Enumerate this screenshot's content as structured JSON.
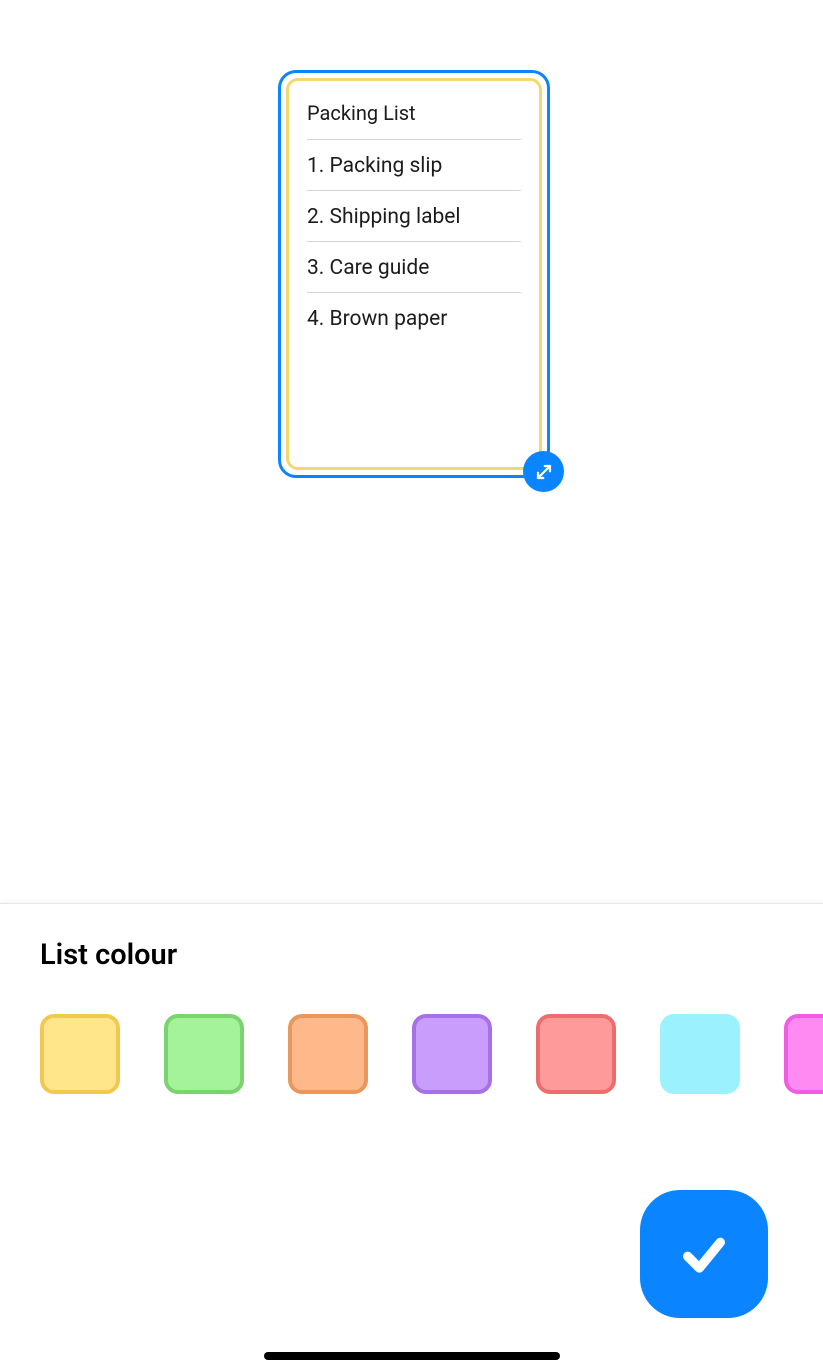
{
  "note": {
    "title": "Packing List",
    "items": [
      "1. Packing slip",
      "2. Shipping label",
      "3. Care guide",
      "4. Brown paper"
    ]
  },
  "sheet": {
    "title": "List colour"
  },
  "colors": [
    {
      "name": "yellow"
    },
    {
      "name": "green"
    },
    {
      "name": "orange"
    },
    {
      "name": "purple"
    },
    {
      "name": "red"
    },
    {
      "name": "cyan"
    },
    {
      "name": "pink"
    }
  ]
}
